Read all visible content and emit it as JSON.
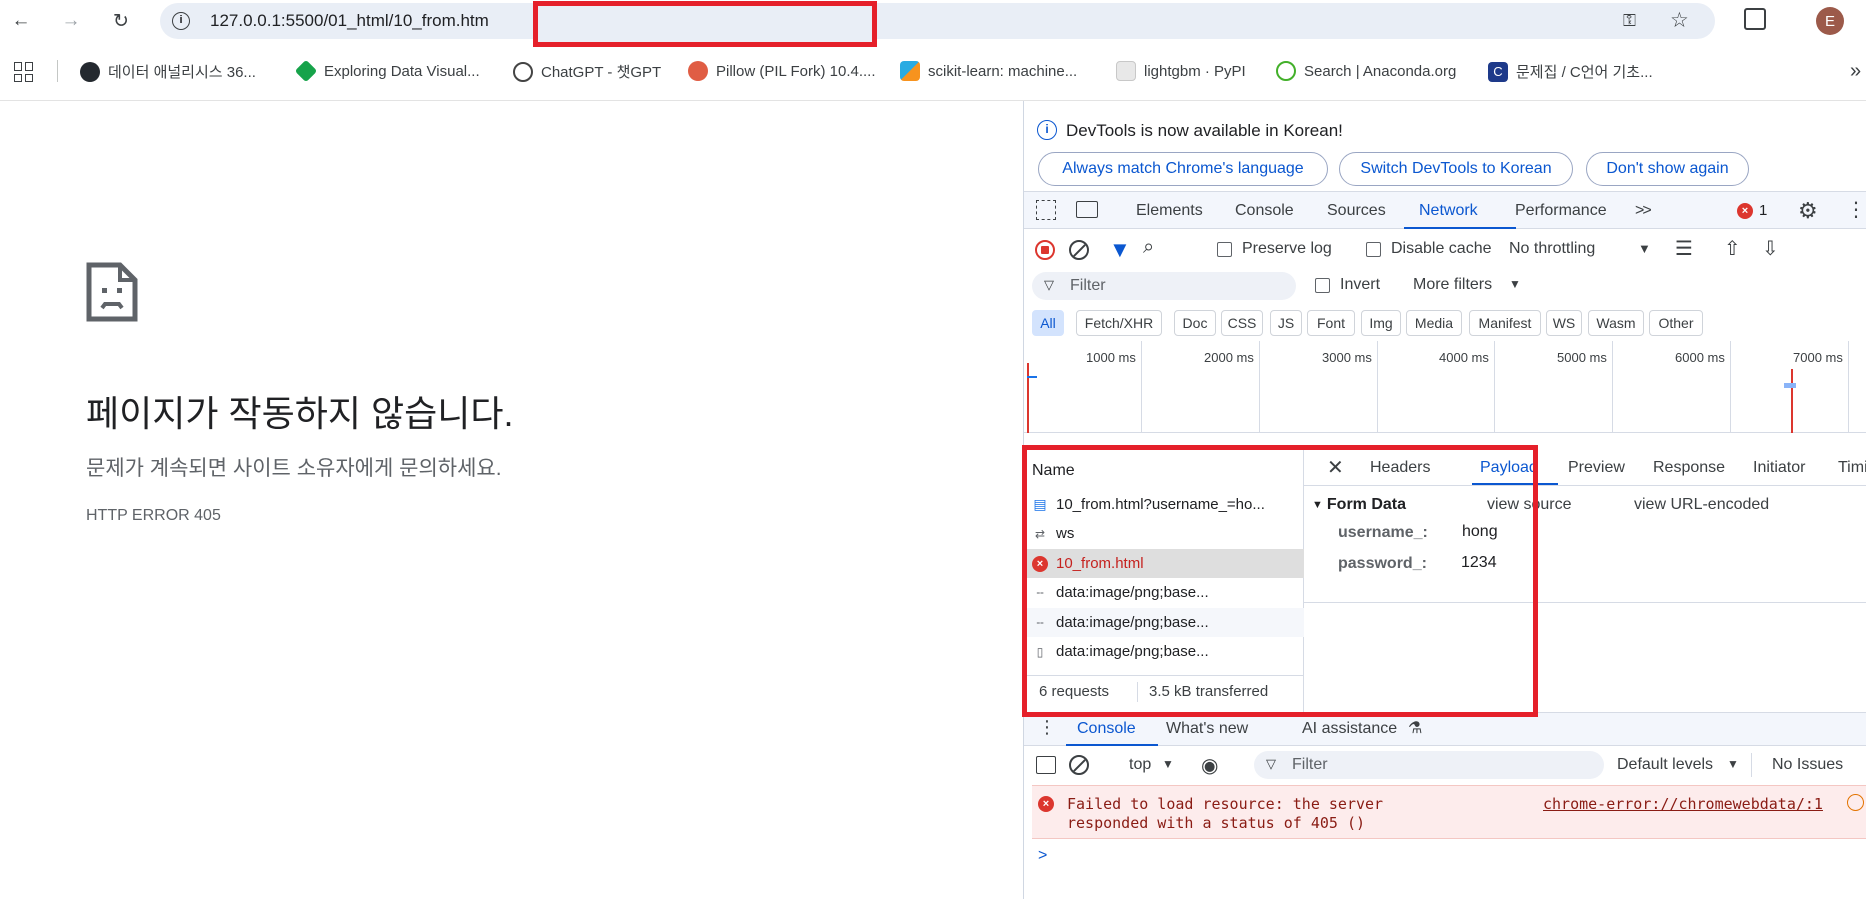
{
  "browser": {
    "url": "127.0.0.1:5500/01_html/10_from.htm",
    "profile_initial": "E",
    "bookmarks": [
      {
        "label": "데이터 애널리시스 36...",
        "color": "#24292f"
      },
      {
        "label": "Exploring Data Visual...",
        "color": "#16a34a"
      },
      {
        "label": "ChatGPT - 챗GPT",
        "color": "#444444"
      },
      {
        "label": "Pillow (PIL Fork) 10.4....",
        "color": "#e05d44"
      },
      {
        "label": "scikit-learn: machine...",
        "color": "#f7931e"
      },
      {
        "label": "lightgbm · PyPI",
        "color": "#cfcfcf"
      },
      {
        "label": "Search | Anaconda.org",
        "color": "#43b02a"
      },
      {
        "label": "문제집 / C언어 기초...",
        "color": "#1e3a8a"
      }
    ],
    "more_bookmarks": "»"
  },
  "error_page": {
    "title": "페이지가 작동하지 않습니다.",
    "subtitle": "문제가 계속되면 사이트 소유자에게 문의하세요.",
    "code": "HTTP ERROR 405"
  },
  "devtools": {
    "info_text": "DevTools is now available in Korean!",
    "info_buttons": [
      "Always match Chrome's language",
      "Switch DevTools to Korean",
      "Don't show again"
    ],
    "tabs": [
      "Elements",
      "Console",
      "Sources",
      "Network",
      "Performance"
    ],
    "active_tab": "Network",
    "more_tabs": ">>",
    "error_count": "1",
    "toolbar": {
      "preserve_log": "Preserve log",
      "disable_cache": "Disable cache",
      "throttling": "No throttling"
    },
    "filter": {
      "placeholder": "Filter",
      "invert": "Invert",
      "more_filters": "More filters"
    },
    "type_filters": [
      "All",
      "Fetch/XHR",
      "Doc",
      "CSS",
      "JS",
      "Font",
      "Img",
      "Media",
      "Manifest",
      "WS",
      "Wasm",
      "Other"
    ],
    "timeline_labels": [
      "1000 ms",
      "2000 ms",
      "3000 ms",
      "4000 ms",
      "5000 ms",
      "6000 ms",
      "7000 ms"
    ],
    "requests": {
      "header": "Name",
      "rows": [
        {
          "name": "10_from.html?username_=ho...",
          "icon": "doc-icon",
          "error": false
        },
        {
          "name": "ws",
          "icon": "websocket-icon",
          "error": false
        },
        {
          "name": "10_from.html",
          "icon": "error-icon",
          "error": true
        },
        {
          "name": "data:image/png;base...",
          "icon": "image-icon",
          "error": false
        },
        {
          "name": "data:image/png;base...",
          "icon": "image-icon",
          "error": false
        },
        {
          "name": "data:image/png;base...",
          "icon": "file-icon",
          "error": false
        }
      ],
      "summary_requests": "6 requests",
      "summary_transferred": "3.5 kB transferred"
    },
    "detail": {
      "tabs": [
        "Headers",
        "Payload",
        "Preview",
        "Response",
        "Initiator",
        "Timing"
      ],
      "active_tab": "Payload",
      "section": "Form Data",
      "view_source": "view source",
      "view_url_encoded": "view URL-encoded",
      "fields": [
        {
          "key": "username_:",
          "value": "hong"
        },
        {
          "key": "password_:",
          "value": "1234"
        }
      ]
    },
    "drawer": {
      "tabs": [
        "Console",
        "What's new",
        "AI assistance"
      ],
      "context": "top",
      "filter_placeholder": "Filter",
      "levels": "Default levels",
      "issues": "No Issues",
      "error_message": "Failed to load resource: the server responded with a status of 405 ()",
      "error_line1": "Failed to load resource: the server",
      "error_line2": "responded with a status of 405 ()",
      "error_source": "chrome-error://chromewebdata/:1",
      "prompt": ">"
    }
  }
}
